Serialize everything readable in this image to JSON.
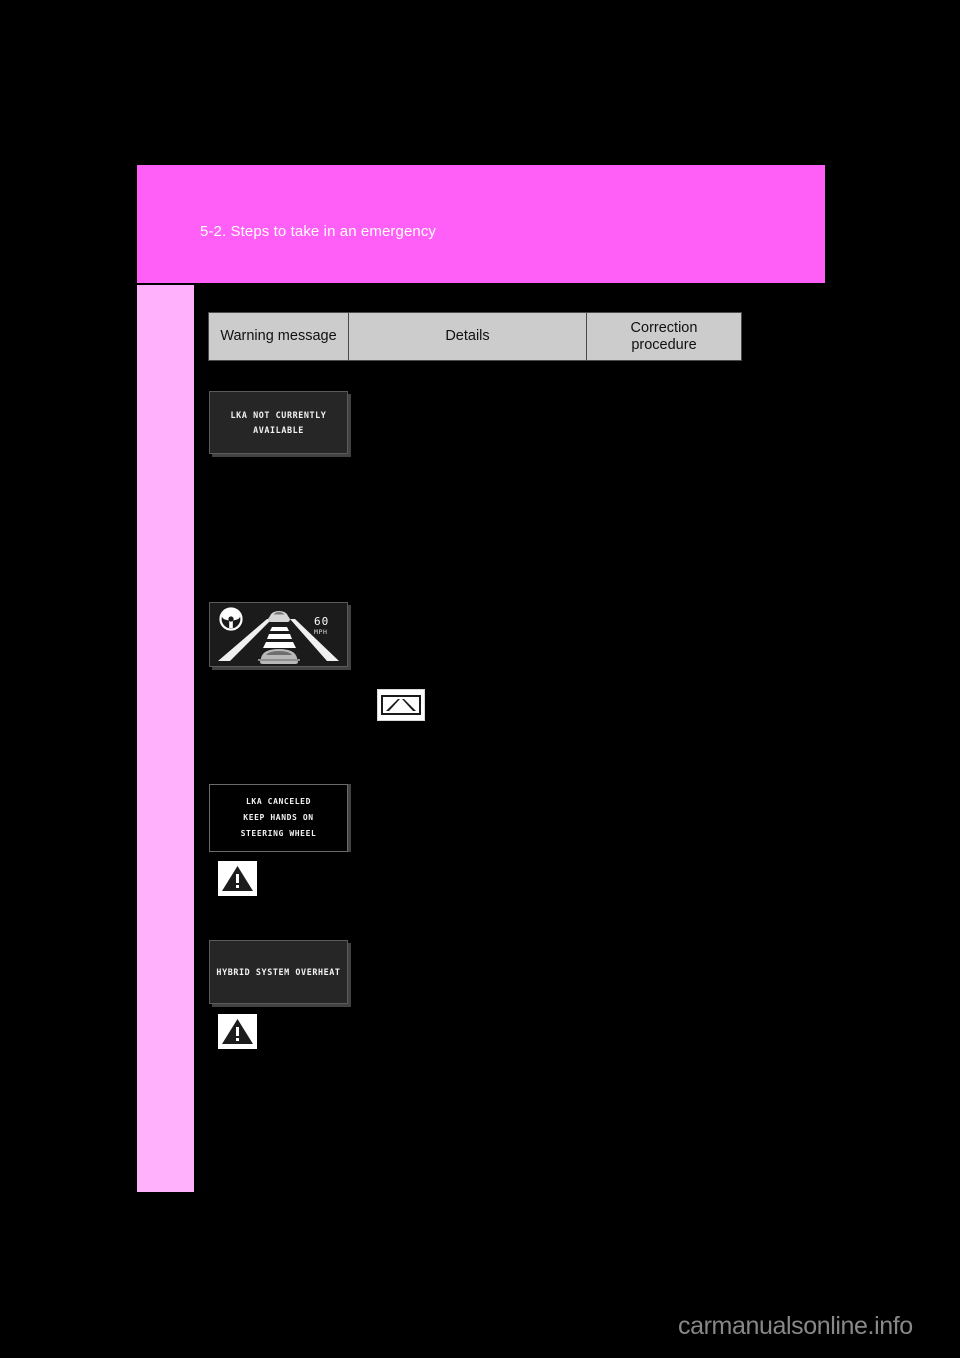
{
  "page": {
    "background_color": "#000000",
    "header_band_color": "#ff5ef7",
    "side_tab_color": "#ffb2fb",
    "section_title": "5-2. Steps to take in an emergency"
  },
  "table": {
    "columns": [
      {
        "label": "Warning message",
        "name": "warning-message"
      },
      {
        "label": "Details",
        "name": "details"
      },
      {
        "label": "Correction procedure",
        "label_line1": "Correction",
        "label_line2": "procedure",
        "name": "correction-procedure"
      }
    ]
  },
  "displays": [
    {
      "id": "lka-not-currently-available",
      "type": "text-message",
      "text": "LKA NOT CURRENTLY AVAILABLE"
    },
    {
      "id": "lane-keeping-assist-view",
      "type": "graphic",
      "speed_value": "60",
      "speed_unit": "MPH",
      "icons": [
        "steering-wheel-icon",
        "lead-vehicle-icon",
        "own-vehicle-icon",
        "lane-line-left",
        "lane-line-right",
        "lane-markers"
      ]
    },
    {
      "id": "lka-canceled",
      "type": "text-message",
      "text": "LKA CANCELED\nKEEP HANDS ON\nSTEERING WHEEL"
    },
    {
      "id": "hybrid-system-overheat",
      "type": "text-message",
      "text": "HYBRID SYSTEM OVERHEAT"
    }
  ],
  "indicators": [
    {
      "id": "lane-departure-indicator",
      "name": "lane-departure-icon",
      "color": "#ffffff"
    },
    {
      "id": "master-warning-1",
      "name": "warning-triangle-icon",
      "color": "#1c1c1c"
    },
    {
      "id": "master-warning-2",
      "name": "warning-triangle-icon",
      "color": "#1c1c1c"
    }
  ],
  "watermark": {
    "text": "carmanualsonline.info",
    "color": "#888888"
  }
}
